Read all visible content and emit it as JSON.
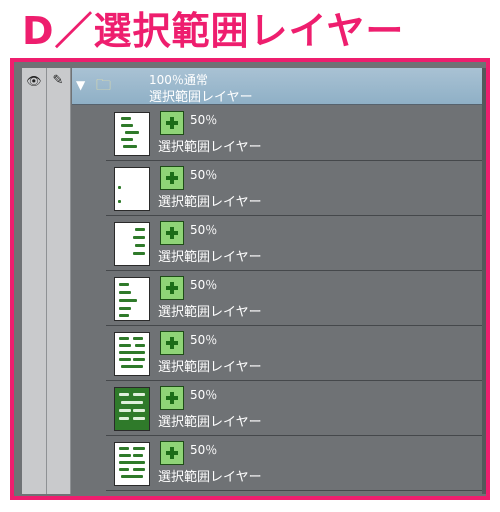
{
  "heading": "D／選択範囲レイヤー",
  "panel": {
    "group": {
      "opacity_mode": "100％通常",
      "name": "選択範囲レイヤー"
    },
    "layers": [
      {
        "opacity": "50％",
        "name": "選択範囲レイヤー",
        "thumb": "white"
      },
      {
        "opacity": "50％",
        "name": "選択範囲レイヤー",
        "thumb": "white"
      },
      {
        "opacity": "50％",
        "name": "選択範囲レイヤー",
        "thumb": "white"
      },
      {
        "opacity": "50％",
        "name": "選択範囲レイヤー",
        "thumb": "white"
      },
      {
        "opacity": "50％",
        "name": "選択範囲レイヤー",
        "thumb": "white"
      },
      {
        "opacity": "50％",
        "name": "選択範囲レイヤー",
        "thumb": "dark"
      },
      {
        "opacity": "50％",
        "name": "選択範囲レイヤー",
        "thumb": "white"
      }
    ]
  },
  "colors": {
    "accent": "#ee1e6e",
    "panel_bg": "#6f7275",
    "selected_row": "#9ab7cb",
    "mask_green": "#8fd477"
  },
  "icons": [
    "eye-icon",
    "pen-icon",
    "chevron-down-icon",
    "folder-icon",
    "layer-mask-icon"
  ]
}
